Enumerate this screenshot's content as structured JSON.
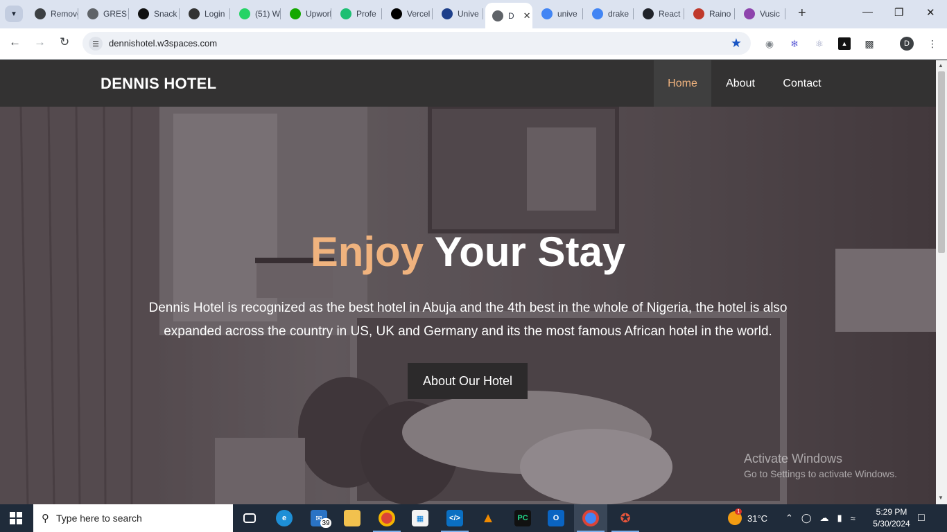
{
  "browser": {
    "tabs": [
      {
        "title": "Remove",
        "icon": "openai-icon",
        "color": "#3c4043"
      },
      {
        "title": "GRES",
        "icon": "globe-icon",
        "color": "#5f6368"
      },
      {
        "title": "Snack",
        "icon": "snack-icon",
        "color": "#111111"
      },
      {
        "title": "Login",
        "icon": "cube-icon",
        "color": "#333333"
      },
      {
        "title": "(51) W",
        "icon": "whatsapp-icon",
        "color": "#25d366"
      },
      {
        "title": "Upwork",
        "icon": "upwork-icon",
        "color": "#14a800"
      },
      {
        "title": "Profe",
        "icon": "fiverr-icon",
        "color": "#1dbf73"
      },
      {
        "title": "Vercel",
        "icon": "vercel-icon",
        "color": "#000000"
      },
      {
        "title": "Unive",
        "icon": "uk-flag-icon",
        "color": "#1d3f8a"
      },
      {
        "title": "D",
        "icon": "globe-icon",
        "color": "#5f6368",
        "active": true
      },
      {
        "title": "unive",
        "icon": "google-icon",
        "color": "#4285f4"
      },
      {
        "title": "drake",
        "icon": "google-icon",
        "color": "#4285f4"
      },
      {
        "title": "React",
        "icon": "react-icon",
        "color": "#20232a"
      },
      {
        "title": "Raino",
        "icon": "hot-icon",
        "color": "#c0392b"
      },
      {
        "title": "Vusic",
        "icon": "vusic-icon",
        "color": "#8e44ad"
      }
    ],
    "url": "dennishotel.w3spaces.com",
    "profile_initial": "D"
  },
  "site": {
    "brand": "DENNIS HOTEL",
    "nav": [
      {
        "label": "Home",
        "active": true
      },
      {
        "label": "About",
        "active": false
      },
      {
        "label": "Contact",
        "active": false
      }
    ],
    "hero": {
      "title_accent": "Enjoy",
      "title_rest": "Your Stay",
      "text": "Dennis Hotel is recognized as the best hotel in Abuja and the 4th best in the whole of Nigeria, the hotel is also expanded across the country in US, UK and Germany and its the most famous African hotel in the world.",
      "button": "About Our Hotel"
    },
    "accent_color": "#f0b37e"
  },
  "overlay": {
    "activate_title": "Activate Windows",
    "activate_sub": "Go to Settings to activate Windows."
  },
  "taskbar": {
    "search_placeholder": "Type here to search",
    "mail_badge": "39",
    "weather": "31°C",
    "weather_badge": "1",
    "time": "5:29 PM",
    "date": "5/30/2024"
  }
}
